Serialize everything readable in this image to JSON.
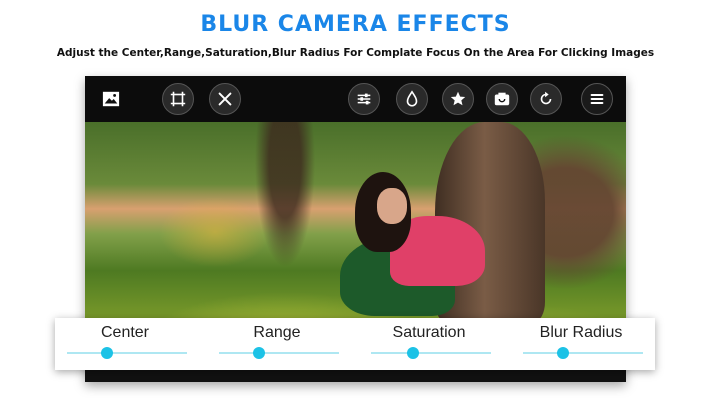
{
  "header": {
    "title": "BLUR CAMERA EFFECTS",
    "subtitle": "Adjust the Center,Range,Saturation,Blur Radius For Complate Focus On the Area For Clicking Images"
  },
  "toolbar": {
    "left_buttons": [
      "image-icon",
      "crop-icon",
      "close-icon"
    ],
    "right_buttons": [
      "adjust-icon",
      "drop-icon",
      "star-icon",
      "camera-icon",
      "rotate-icon",
      "menu-icon"
    ]
  },
  "sliders": [
    {
      "label": "Center",
      "value": 0.33
    },
    {
      "label": "Range",
      "value": 0.33
    },
    {
      "label": "Saturation",
      "value": 0.35
    },
    {
      "label": "Blur Radius",
      "value": 0.33
    }
  ],
  "colors": {
    "title": "#1a86e8",
    "accent": "#1cc2e6",
    "track": "#aee7f2",
    "toolbar": "#0c0c0c"
  }
}
